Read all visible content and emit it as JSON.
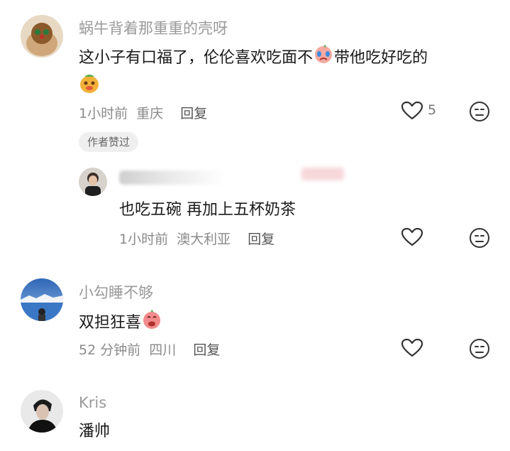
{
  "comments": [
    {
      "username": "蜗牛背着那重重的壳呀",
      "text_line1": "这小子有口福了，伦伦喜欢吃面不",
      "text_after_emoji": "带他吃好吃的",
      "time": "1小时前",
      "location": "重庆",
      "reply_label": "回复",
      "like_count": "5",
      "badge": "作者赞过",
      "emojis": [
        "crying-face-emoji",
        "chestnut-face-emoji"
      ]
    },
    {
      "username": "",
      "text": "也吃五碗 再加上五杯奶茶",
      "time": "1小时前",
      "location": "澳大利亚",
      "reply_label": "回复"
    },
    {
      "username": "小勾睡不够",
      "text": "双担狂喜",
      "time": "52 分钟前",
      "location": "四川",
      "reply_label": "回复",
      "emojis": [
        "happy-pink-face-emoji"
      ]
    },
    {
      "username": "Kris",
      "text": "潘帅"
    }
  ],
  "colors": {
    "username": "#9a9a9a",
    "text": "#1a1a1a",
    "meta": "#8a8a8a",
    "icon": "#333333",
    "badge_bg": "#efefef"
  }
}
